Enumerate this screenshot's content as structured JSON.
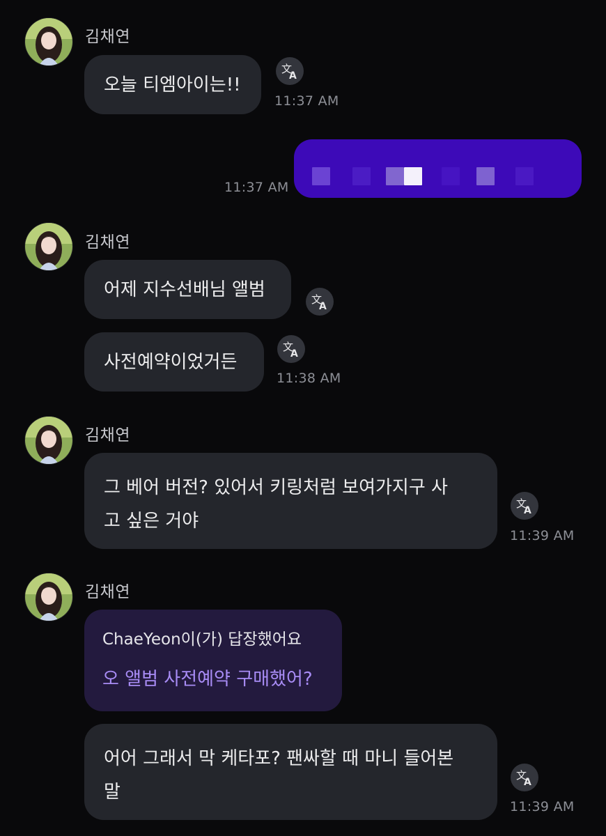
{
  "messages": [
    {
      "sender": "김채연",
      "bubbles": [
        {
          "text": "오늘 티엠아이는!!"
        }
      ],
      "time": "11:37 AM"
    },
    {
      "outgoing": true,
      "time": "11:37 AM"
    },
    {
      "sender": "김채연",
      "bubbles": [
        {
          "text": "어제 지수선배님 앨범"
        },
        {
          "text": "사전예약이었거든"
        }
      ],
      "time": "11:38 AM"
    },
    {
      "sender": "김채연",
      "bubbles": [
        {
          "line1": "그 베어 버전? 있어서 키링처럼 보여가지구 사",
          "line2": "고 싶은 거야"
        }
      ],
      "time": "11:39 AM"
    },
    {
      "sender": "김채연",
      "reply": {
        "who": "ChaeYeon이(가) 답장했어요",
        "text": "오 앨범 사전예약 구매했어?"
      },
      "bubbles": [
        {
          "line1": "어어 그래서 막 케타포? 팬싸할 때 마니 들어본",
          "line2": "말"
        }
      ],
      "time": "11:39 AM"
    }
  ],
  "icons": {
    "translate": "translate-icon",
    "avatar": "profile-photo"
  },
  "colors": {
    "background": "#09090b",
    "bubble": "#24262c",
    "sent_bubble": "#3d0ab8",
    "reply_bubble": "#231a3e",
    "reply_text": "#a88cf5",
    "time": "#8d8f96"
  }
}
